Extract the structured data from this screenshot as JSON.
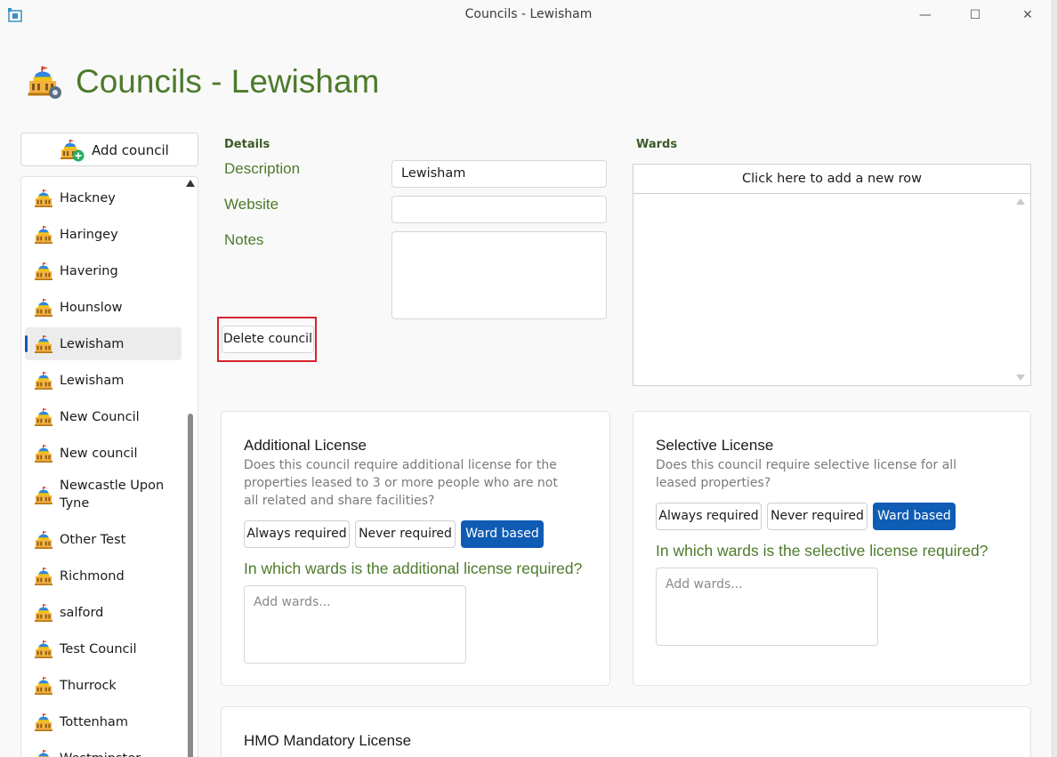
{
  "window": {
    "title": "Councils - Lewisham",
    "minimize": "—",
    "maximize": "☐",
    "close": "✕"
  },
  "page": {
    "title": "Councils - Lewisham"
  },
  "sidebar": {
    "add_label": "Add council",
    "items": [
      {
        "label": "Hackney"
      },
      {
        "label": "Haringey"
      },
      {
        "label": "Havering"
      },
      {
        "label": "Hounslow"
      },
      {
        "label": "Lewisham",
        "selected": true
      },
      {
        "label": "Lewisham"
      },
      {
        "label": "New Council"
      },
      {
        "label": "New council"
      },
      {
        "label": "Newcastle Upon Tyne"
      },
      {
        "label": "Other Test"
      },
      {
        "label": "Richmond"
      },
      {
        "label": "salford"
      },
      {
        "label": "Test Council"
      },
      {
        "label": "Thurrock"
      },
      {
        "label": "Tottenham"
      },
      {
        "label": "Westminster"
      }
    ]
  },
  "details": {
    "heading": "Details",
    "description_label": "Description",
    "description_value": "Lewisham",
    "website_label": "Website",
    "website_value": "",
    "notes_label": "Notes",
    "notes_value": "",
    "delete_label": "Delete council"
  },
  "wards": {
    "heading": "Wards",
    "add_row": "Click here to add a new row"
  },
  "additional": {
    "title": "Additional License",
    "desc": "Does this council require additional license for the properties leased to 3 or more people who are not all related and share facilities?",
    "options": [
      "Always required",
      "Never required",
      "Ward based"
    ],
    "selected": "Ward based",
    "question": "In which wards is the additional license required?",
    "wards_placeholder": "Add wards..."
  },
  "selective": {
    "title": "Selective License",
    "desc": "Does this council require selective license for all leased properties?",
    "options": [
      "Always required",
      "Never required",
      "Ward based"
    ],
    "selected": "Ward based",
    "question": "In which wards is the selective license required?",
    "wards_placeholder": "Add wards..."
  },
  "hmo": {
    "title": "HMO Mandatory License"
  },
  "colors": {
    "accent_green": "#4d7a2b",
    "selected_blue": "#0f5cb4",
    "highlight_red": "#d9222a"
  }
}
